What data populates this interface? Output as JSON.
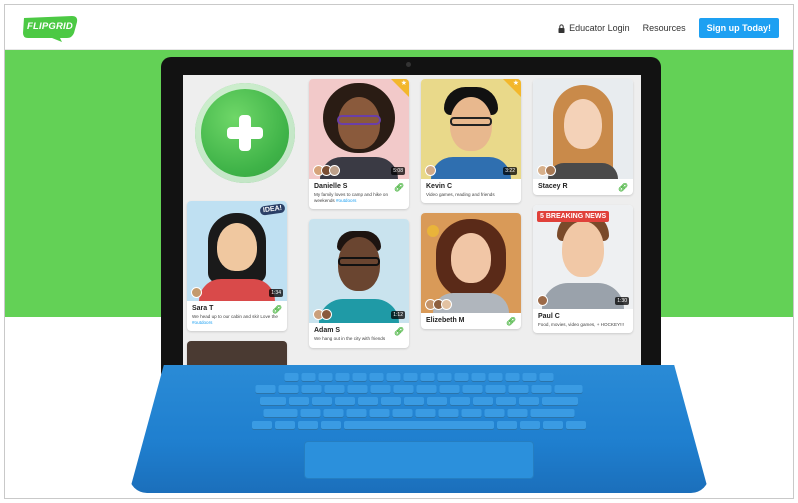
{
  "header": {
    "logo_text": "FLIPGRID",
    "nav": {
      "educator_login": "Educator Login",
      "resources": "Resources",
      "signup": "Sign up Today!"
    }
  },
  "colors": {
    "brand_green": "#63d156",
    "cta_blue": "#1da0f2",
    "keyboard_blue": "#1f7fcf",
    "star_gold": "#f3b72c"
  },
  "icons": [
    "flipgrid-logo-icon",
    "lock-icon",
    "plus-icon",
    "star-icon",
    "link-icon",
    "idea-sticker-icon",
    "medal-icon"
  ],
  "cards": [
    {
      "name": "Danielle S",
      "duration": "5:08",
      "caption": "My family loves to camp and hike on weekends ",
      "hashtag": "#outdoors",
      "featured": true
    },
    {
      "name": "Kevin C",
      "duration": "3:22",
      "caption": "Video games, reading and friends",
      "featured": true
    },
    {
      "name": "Stacey R",
      "duration": "",
      "caption": "",
      "featured": false
    },
    {
      "name": "Sara T",
      "duration": "1:34",
      "caption": "We head up to our cabin and ski! Love the ",
      "hashtag": "#outdoors",
      "sticker": "IDEA!"
    },
    {
      "name": "Adam S",
      "duration": "1:12",
      "caption": "We hang out in the city with friends"
    },
    {
      "name": "Elizebeth M",
      "duration": "",
      "caption": ""
    },
    {
      "name": "Paul C",
      "duration": "1:30",
      "caption": "Food, movies, video games, + HOCKEY!!!",
      "sticker": "5 BREAKING NEWS"
    }
  ]
}
